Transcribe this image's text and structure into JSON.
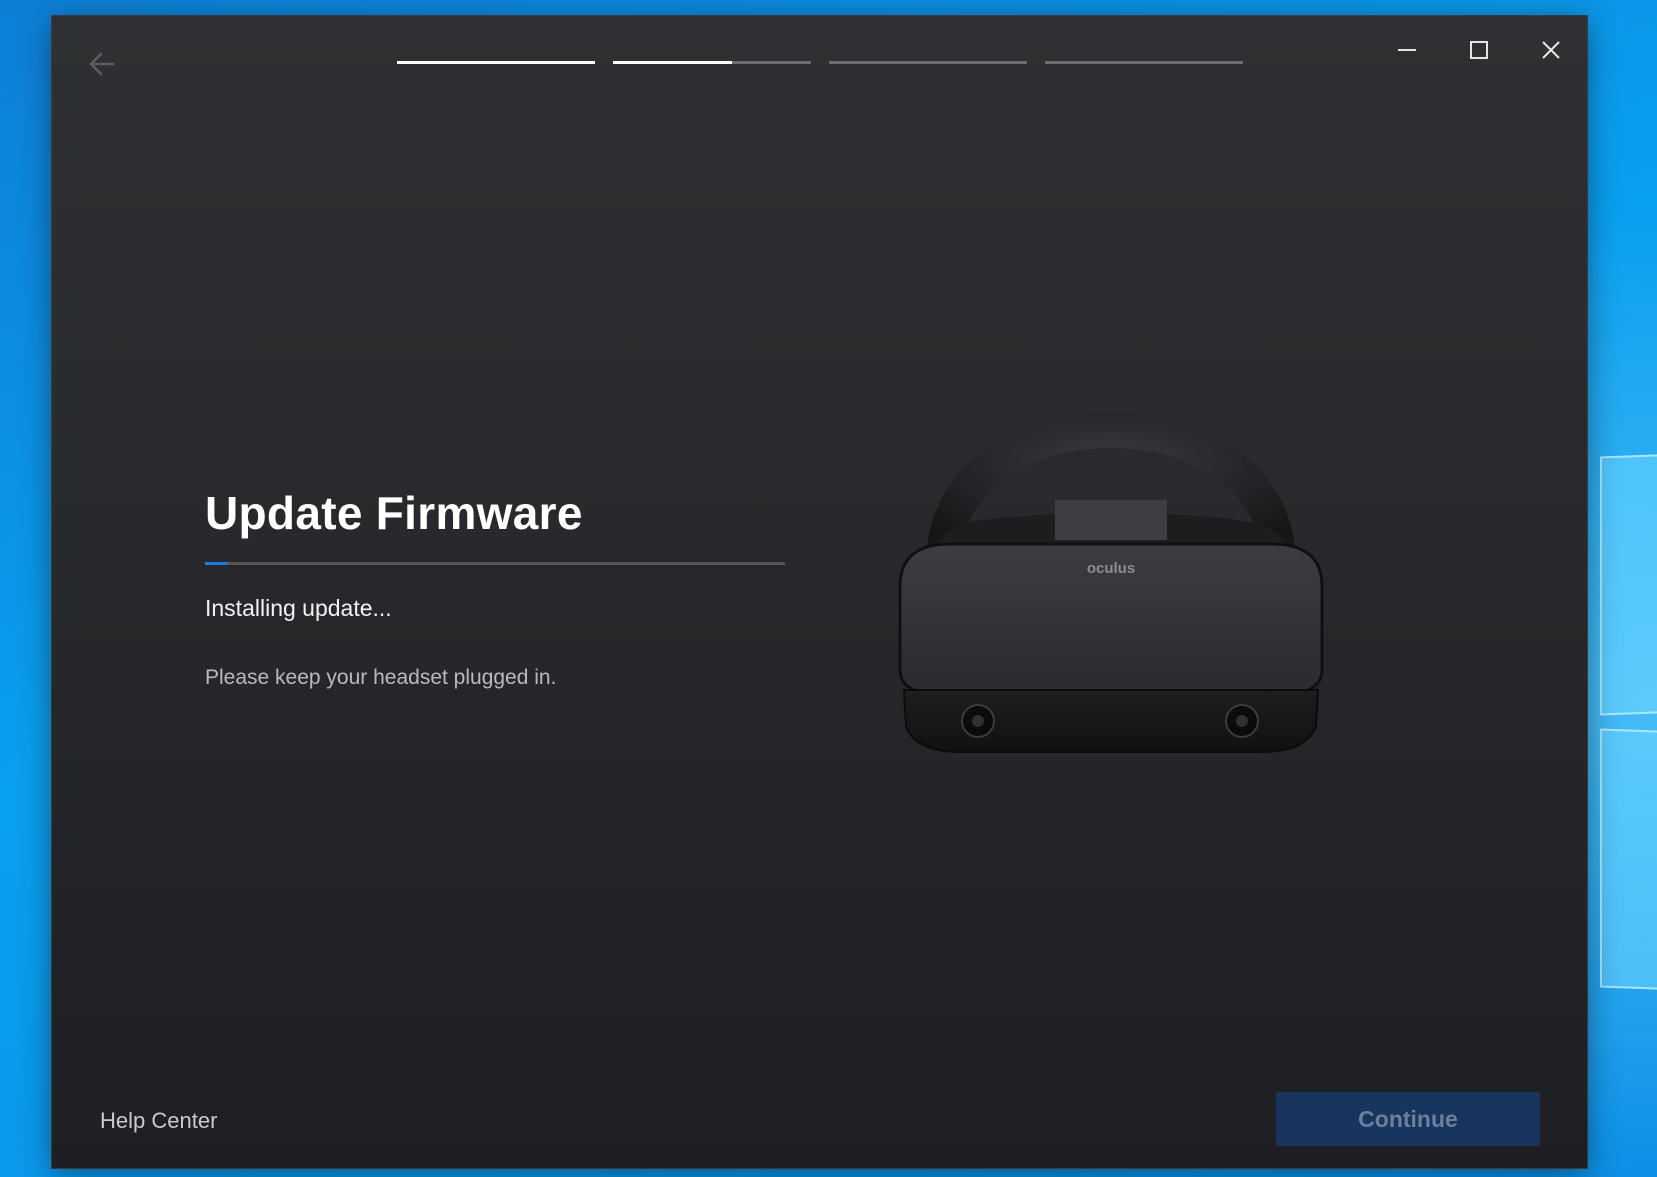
{
  "window": {
    "steps": [
      {
        "progress": 1.0
      },
      {
        "progress": 0.6
      },
      {
        "progress": 0.0
      },
      {
        "progress": 0.0
      }
    ],
    "controls": {
      "minimize_icon": "minimize-icon",
      "maximize_icon": "maximize-icon",
      "close_icon": "close-icon"
    }
  },
  "main": {
    "title": "Update Firmware",
    "progress": 0.04,
    "status": "Installing update...",
    "note": "Please keep your headset plugged in.",
    "headset_logo": "oculus"
  },
  "footer": {
    "help_label": "Help Center",
    "continue_label": "Continue",
    "continue_enabled": false
  },
  "colors": {
    "accent": "#1d7be6",
    "window_bg": "#28292c",
    "button_disabled_bg": "#17355f",
    "desktop_blue": "#0a8fe8"
  }
}
